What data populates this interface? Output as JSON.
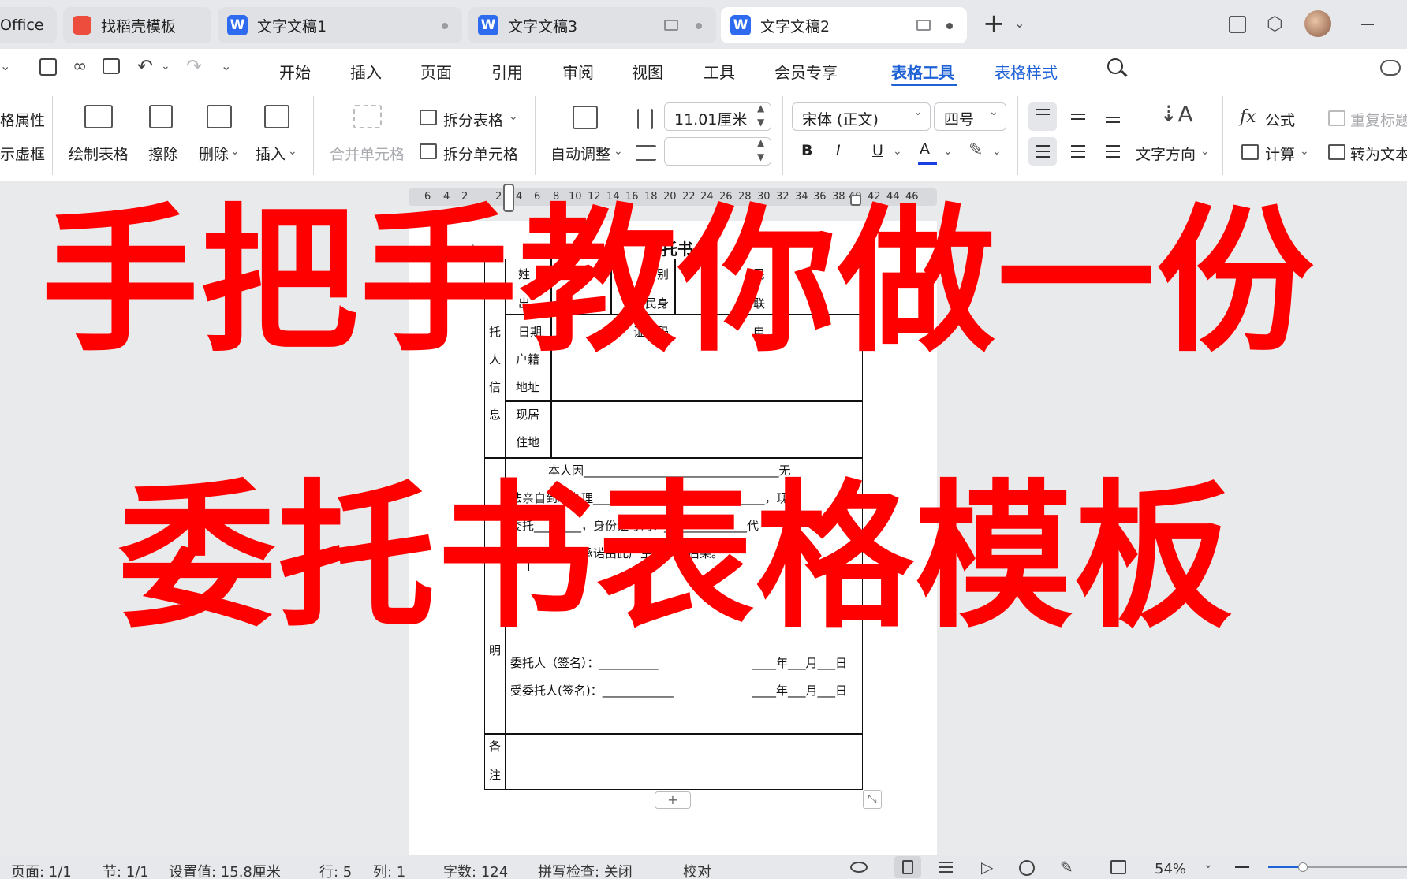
{
  "tabs": {
    "office": "Office",
    "template": "找稻壳模板",
    "doc1": "文字文稿1",
    "doc3": "文字文稿3",
    "doc2": "文字文稿2",
    "new_tab": "+"
  },
  "menu": {
    "items": [
      "开始",
      "插入",
      "页面",
      "引用",
      "审阅",
      "视图",
      "工具",
      "会员专享"
    ],
    "table_tools": "表格工具",
    "table_style": "表格样式"
  },
  "ribbon": {
    "table_props": "格属性",
    "virtual_frame": "示虚框",
    "draw_table": "绘制表格",
    "erase": "擦除",
    "delete": "删除",
    "insert": "插入",
    "merge_cells": "合并单元格",
    "split_table": "拆分表格",
    "split_cells": "拆分单元格",
    "auto_adjust": "自动调整",
    "width_value": "11.01厘米",
    "height_value": "",
    "font_name": "宋体 (正文)",
    "font_size": "四号",
    "bold": "B",
    "italic": "I",
    "underline": "U",
    "font_color": "A",
    "text_direction": "文字方向",
    "formula": "公式",
    "repeat_header": "重复标题",
    "calculate": "计算",
    "convert_text": "转为文本"
  },
  "ruler": {
    "ticks": [
      "6",
      "4",
      "2",
      "2",
      "4",
      "6",
      "8",
      "10",
      "12",
      "14",
      "16",
      "18",
      "20",
      "22",
      "24",
      "26",
      "28",
      "30",
      "32",
      "34",
      "36",
      "38",
      "40",
      "42",
      "44",
      "46"
    ]
  },
  "document": {
    "title_fragment": "托书",
    "row1": [
      "姓",
      "别",
      "民"
    ],
    "row2_a": [
      "出",
      "居民身",
      "联"
    ],
    "row2_b": [
      "日期",
      "证号码",
      "电"
    ],
    "section1_label": [
      "托",
      "人",
      "信",
      "息"
    ],
    "household": [
      "户籍",
      "地址"
    ],
    "residence": [
      "现居",
      "住地"
    ],
    "stmt1": "本人因_________________________________无",
    "stmt2": "法亲自到场办理_____________________________，现",
    "stmt3": "委托________，身份证号码：______________代",
    "stmt4": "为办理。本人承诺由此产生的一切后果。",
    "section2_label": "明",
    "principal_sign": "委托人（签名）：__________",
    "principal_date": "____年___月___日",
    "agent_sign": "受委托人(签名)：____________",
    "agent_date": "____年___月___日",
    "remark": [
      "备",
      "注"
    ],
    "add_row": "+"
  },
  "overlay": {
    "line1": "手把手教你做一份",
    "line2": "委托书表格模板"
  },
  "status": {
    "page": "页面: 1/1",
    "section": "节: 1/1",
    "setting": "设置值: 15.8厘米",
    "row": "行: 5",
    "col": "列: 1",
    "words": "字数: 124",
    "spell": "拼写检查: 关闭",
    "proof": "校对",
    "zoom": "54%"
  }
}
